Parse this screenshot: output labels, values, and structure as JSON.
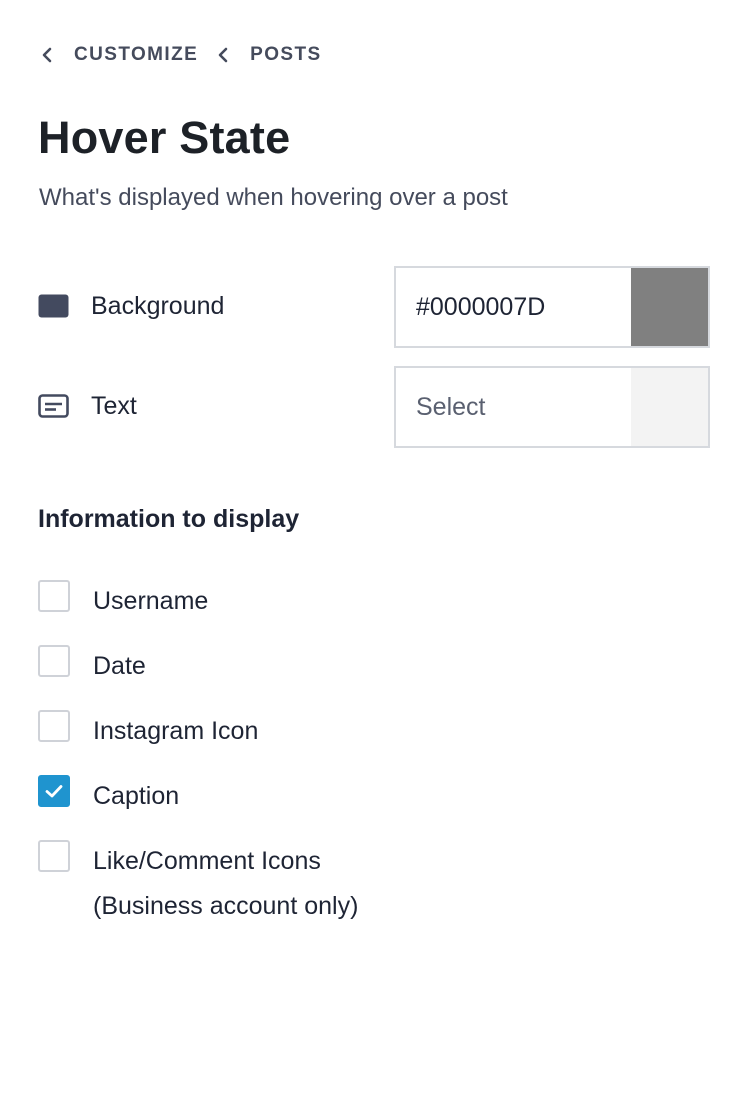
{
  "breadcrumb": {
    "items": [
      {
        "label": "CUSTOMIZE",
        "icon": "chevron-left-icon"
      },
      {
        "label": "POSTS",
        "icon": "chevron-left-icon"
      }
    ]
  },
  "header": {
    "title": "Hover State",
    "subtitle": "What's displayed when hovering over a post"
  },
  "colors": {
    "background": {
      "label": "Background",
      "icon": "color-swatch-icon",
      "value": "#0000007D",
      "swatch_color": "#808080"
    },
    "text": {
      "label": "Text",
      "icon": "text-box-icon",
      "placeholder": "Select",
      "swatch_color": "#f3f3f3"
    }
  },
  "info": {
    "title": "Information to display",
    "options": [
      {
        "label": "Username",
        "checked": false
      },
      {
        "label": "Date",
        "checked": false
      },
      {
        "label": "Instagram Icon",
        "checked": false
      },
      {
        "label": "Caption",
        "checked": true
      },
      {
        "label": "Like/Comment Icons",
        "label_line2": "(Business account only)",
        "checked": false
      }
    ]
  },
  "theme": {
    "accent": "#1f94cf",
    "icon_color": "#434a5f",
    "text_color": "#1e2434",
    "muted_color": "#454b5c"
  }
}
